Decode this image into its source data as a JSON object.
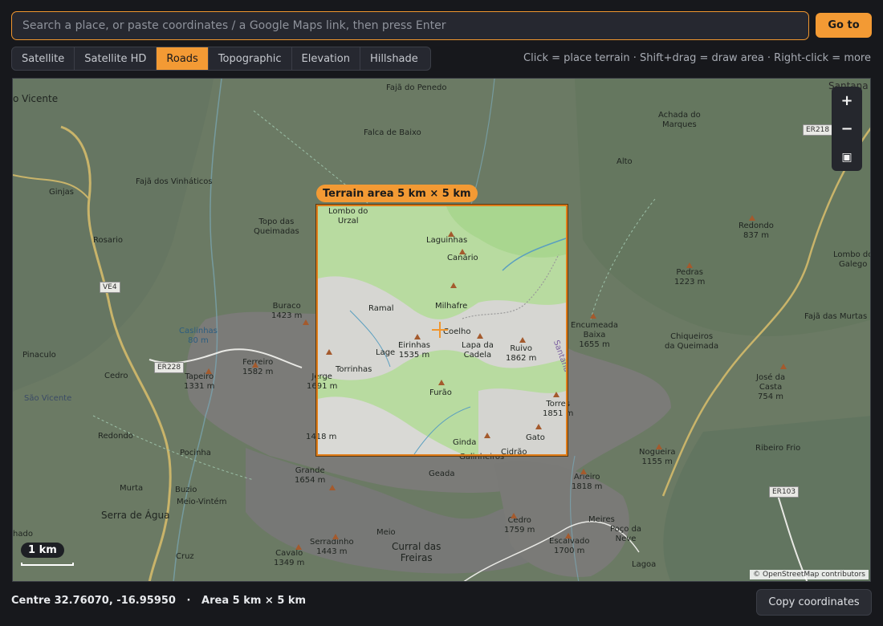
{
  "search": {
    "placeholder": "Search a place, or paste coordinates / a Google Maps link, then press Enter",
    "value": "",
    "go_label": "Go to"
  },
  "layers": {
    "tabs": [
      "Satellite",
      "Satellite HD",
      "Roads",
      "Topographic",
      "Elevation",
      "Hillshade"
    ],
    "active": "Roads"
  },
  "help_text": "Click = place terrain · Shift+drag = draw area · Right-click = more",
  "map": {
    "zoom_in": "+",
    "zoom_out": "−",
    "fullscreen": "▣",
    "terrain_badge": "Terrain area  5 km × 5 km",
    "scale_label": "1 km",
    "attribution": "© OpenStreetMap contributors",
    "labels": [
      "Fajã do Penedo",
      "Santana",
      "o Vicente",
      "Falca de Baixo",
      "Achada do\nMarques",
      "Alto",
      "Fajã dos Vinháticos",
      "Ginjas",
      "Rosario",
      "Topo das\nQueimadas",
      "Redondo\n837 m",
      "Lombo do\nGalego",
      "Pedras\n1223 m",
      "Fajã das Murtas",
      "Buraco\n1423 m",
      "Caslinhas\n80 m",
      "Encumeada\nBaixa\n1655 m",
      "Chiqueiros\nda Queimada",
      "Pinaculo",
      "Cedro",
      "Ferreiro\n1582 m",
      "Tapeiro\n1331 m",
      "José da\nCasta\n754 m",
      "São Vicente",
      "Redondo",
      "Pocinha",
      "Ribeiro Frio",
      "Nogueira\n1155 m",
      "1418 m",
      "Grande\n1654 m",
      "Geada",
      "Arieiro\n1818 m",
      "Murta",
      "Buzio",
      "Meio-Vintém",
      "Serra de Água",
      "Cedro\n1759 m",
      "Meires",
      "Poço da\nNeve",
      "Meio",
      "Escalvado\n1700 m",
      "Curral das\nFreiras",
      "Serradinho\n1443 m",
      "Cavalo\n1349 m",
      "Cruz",
      "Lagoa",
      "hado",
      "Lombo do\nUrzal",
      "Laguinhas",
      "Canário",
      "Ramal",
      "Milhafre",
      "Coelho",
      "Eirinhas\n1535 m",
      "Lage",
      "Lapa da\nCadela",
      "Ruivo\n1862 m",
      "Torrinhas",
      "Jerge\n1691 m",
      "Furão",
      "Torres\n1851 m",
      "Ginda",
      "Gato",
      "Galinheiros",
      "Cidrão",
      "Santana"
    ],
    "road_shields": [
      "ER218",
      "VE4",
      "ER228",
      "ER103"
    ]
  },
  "status": {
    "text": "Centre 32.76070, -16.95950   ·   Area 5 km × 5 km",
    "copy_label": "Copy coordinates"
  }
}
